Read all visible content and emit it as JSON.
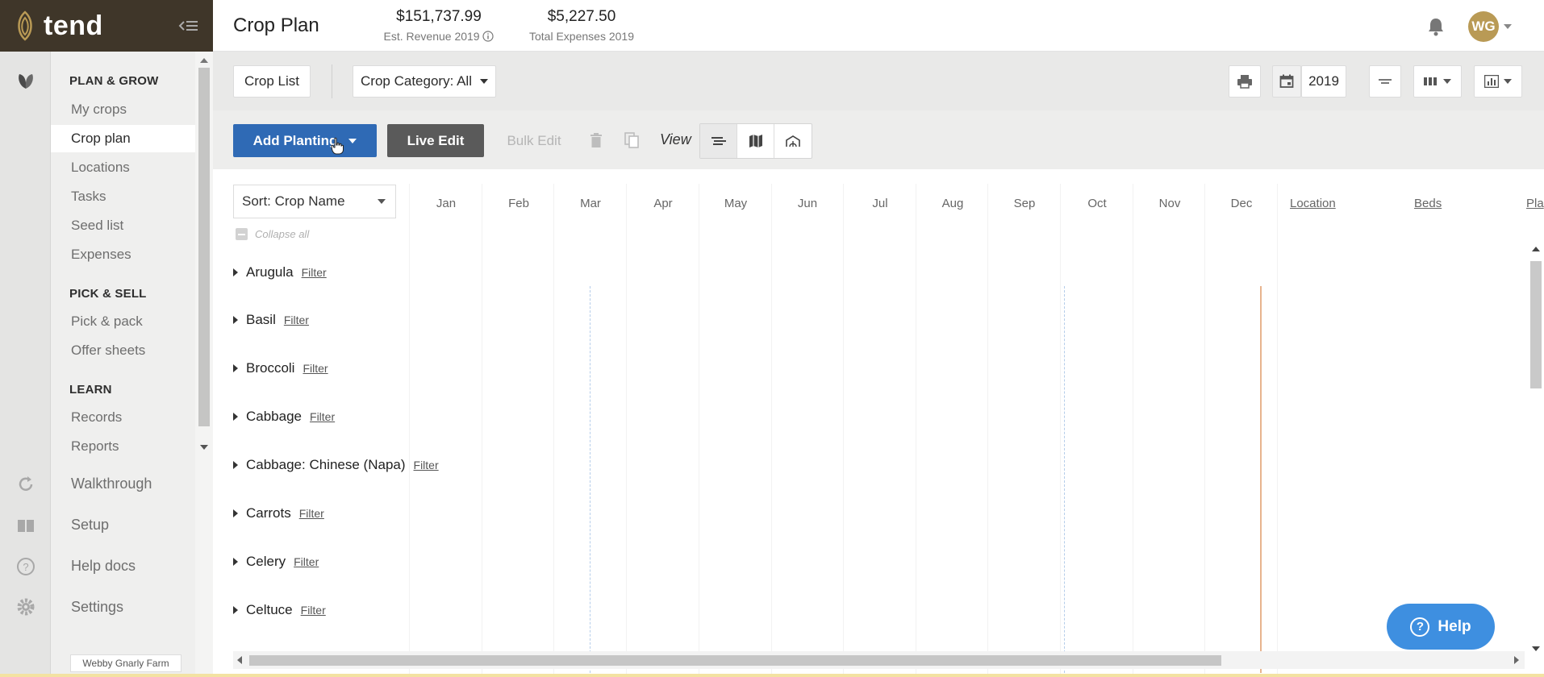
{
  "brand": {
    "name": "tend"
  },
  "header": {
    "title": "Crop Plan",
    "revenue_value": "$151,737.99",
    "revenue_label": "Est. Revenue 2019",
    "expenses_value": "$5,227.50",
    "expenses_label": "Total Expenses 2019",
    "avatar_initials": "WG"
  },
  "sidebar": {
    "sections": [
      {
        "heading": "PLAN & GROW",
        "items": [
          "My crops",
          "Crop plan",
          "Locations",
          "Tasks",
          "Seed list",
          "Expenses"
        ]
      },
      {
        "heading": "PICK & SELL",
        "items": [
          "Pick & pack",
          "Offer sheets"
        ]
      },
      {
        "heading": "LEARN",
        "items": [
          "Records",
          "Reports"
        ]
      }
    ],
    "active_item": "Crop plan",
    "bottom_items": [
      "Walkthrough",
      "Setup",
      "Help docs",
      "Settings"
    ],
    "farm_name": "Webby Gnarly Farm"
  },
  "toolbar": {
    "crop_list": "Crop List",
    "crop_category": "Crop Category: All",
    "year": "2019",
    "add_planting": "Add Planting",
    "live_edit": "Live Edit",
    "bulk_edit": "Bulk Edit",
    "view_label": "View"
  },
  "plan": {
    "sort_label": "Sort: Crop Name",
    "collapse_all": "Collapse all",
    "months": [
      "Jan",
      "Feb",
      "Mar",
      "Apr",
      "May",
      "Jun",
      "Jul",
      "Aug",
      "Sep",
      "Oct",
      "Nov",
      "Dec"
    ],
    "extra_columns": [
      "Location",
      "Beds",
      "Pla"
    ],
    "filter_label": "Filter",
    "crops": [
      "Arugula",
      "Basil",
      "Broccoli",
      "Cabbage",
      "Cabbage: Chinese (Napa)",
      "Carrots",
      "Celery",
      "Celtuce"
    ]
  },
  "help": {
    "label": "Help"
  },
  "colors": {
    "brand_bar": "#3f3629",
    "primary": "#2f6ab5",
    "help": "#3e8fe0",
    "avatar": "#b99a55",
    "today_line": "#e8b48f"
  }
}
